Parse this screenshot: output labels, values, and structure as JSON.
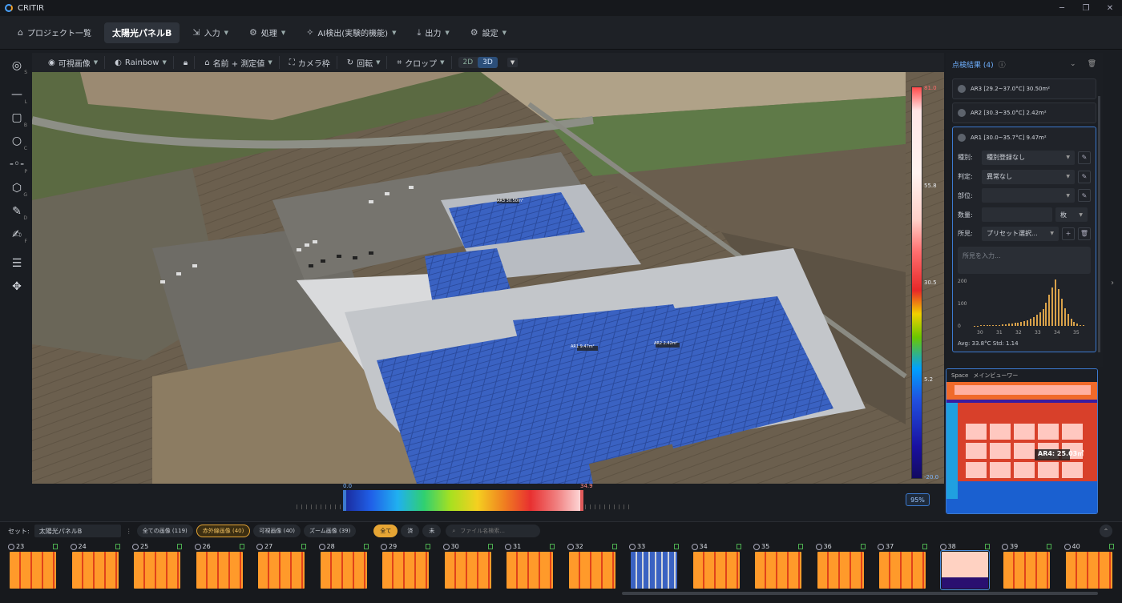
{
  "app": {
    "title": "CRITIR",
    "win_min": "─",
    "win_max": "❐",
    "win_close": "✕"
  },
  "menu": [
    {
      "icon": "⌂",
      "label": "プロジェクト一覧",
      "active": false,
      "caret": false
    },
    {
      "icon": "",
      "label": "太陽光パネルB",
      "active": true,
      "caret": false
    },
    {
      "icon": "⇲",
      "label": "入力",
      "active": false,
      "caret": true
    },
    {
      "icon": "⚙",
      "label": "処理",
      "active": false,
      "caret": true
    },
    {
      "icon": "✧",
      "label": "AI検出(実験的機能)",
      "active": false,
      "caret": true
    },
    {
      "icon": "⤓",
      "label": "出力",
      "active": false,
      "caret": true
    },
    {
      "icon": "⚙",
      "label": "設定",
      "active": false,
      "caret": true
    }
  ],
  "tools": [
    {
      "name": "select-tool",
      "glyph": "◎",
      "key": "S"
    },
    {
      "name": "line-tool",
      "glyph": "—",
      "key": "L"
    },
    {
      "name": "box-tool",
      "glyph": "▢",
      "key": "B"
    },
    {
      "name": "circle-tool",
      "glyph": "○",
      "key": "C"
    },
    {
      "name": "point-tool",
      "glyph": "-◦-",
      "key": "P"
    },
    {
      "name": "polygon-tool",
      "glyph": "⬡",
      "key": "G"
    },
    {
      "name": "draw-tool",
      "glyph": "✎",
      "key": "D"
    },
    {
      "name": "free-tool",
      "glyph": "✍",
      "key": "F"
    },
    {
      "name": "adjust-tool",
      "glyph": "☰",
      "key": ""
    },
    {
      "name": "move-tool",
      "glyph": "✥",
      "key": ""
    }
  ],
  "viewbar": {
    "visible": "可視画像",
    "palette": "Rainbow",
    "label_mode": "名前 + 測定値",
    "camera": "カメラ枠",
    "rotate": "回転",
    "crop": "クロップ",
    "mode2d": "2D",
    "mode3d": "3D"
  },
  "colorbar": {
    "max": "81.0",
    "v2": "55.8",
    "v3": "30.5",
    "v4": "5.2",
    "min": "-20.0"
  },
  "histbar": {
    "min": "0.0",
    "max": "34.9",
    "zoom": "95%"
  },
  "viewport_labels": {
    "l1": "AR3 30.50m²",
    "l2": "AR1 9.47m²",
    "l3": "AR2 2.42m²"
  },
  "results": {
    "title": "点検結果 (4)",
    "areas": [
      {
        "label": "AR3 [29.2~37.0°C] 30.50m²"
      },
      {
        "label": "AR2 [30.3~35.0°C] 2.42m²"
      },
      {
        "label": "AR1 [30.0~35.7°C] 9.47m²"
      }
    ],
    "fields": {
      "type_label": "種別:",
      "type_value": "種別登録なし",
      "judge_label": "判定:",
      "judge_value": "異常なし",
      "part_label": "部位:",
      "part_value": "",
      "qty_label": "数量:",
      "qty_unit": "枚",
      "note_label": "所見:",
      "note_value": "プリセット選択...",
      "memo_placeholder": "所見を入力..."
    },
    "histogram": {
      "yticks": [
        "200",
        "100",
        "0"
      ],
      "xticks": [
        "30",
        "31",
        "32",
        "33",
        "34",
        "35"
      ],
      "bins": [
        1,
        1,
        2,
        2,
        2,
        3,
        3,
        2,
        3,
        4,
        5,
        6,
        7,
        8,
        9,
        11,
        13,
        15,
        18,
        22,
        28,
        35,
        44,
        60,
        80,
        100,
        120,
        95,
        70,
        45,
        30,
        18,
        10,
        6,
        3,
        2
      ],
      "stats": "Avg: 33.8°C   Std: 1.14"
    }
  },
  "minimap": {
    "space": "Space",
    "title": "メインビューワー",
    "tag": "AR4: 25.03㎡"
  },
  "filmbar": {
    "set_label": "セット:",
    "set_value": "太陽光パネルB",
    "filters": [
      {
        "label": "全ての画像 (119)",
        "on": false
      },
      {
        "label": "赤外線画像 (40)",
        "on": true
      },
      {
        "label": "可視画像 (40)",
        "on": false
      },
      {
        "label": "ズーム画像 (39)",
        "on": false
      }
    ],
    "status": [
      {
        "label": "全て",
        "on": true
      },
      {
        "label": "済",
        "on": false
      },
      {
        "label": "未",
        "on": false
      }
    ],
    "search_placeholder": "ファイル名検索...",
    "thumbs": [
      {
        "num": "23",
        "kind": "ir"
      },
      {
        "num": "24",
        "kind": "ir"
      },
      {
        "num": "25",
        "kind": "ir"
      },
      {
        "num": "26",
        "kind": "ir"
      },
      {
        "num": "27",
        "kind": "ir"
      },
      {
        "num": "28",
        "kind": "ir"
      },
      {
        "num": "29",
        "kind": "ir"
      },
      {
        "num": "30",
        "kind": "ir"
      },
      {
        "num": "31",
        "kind": "ir"
      },
      {
        "num": "32",
        "kind": "ir"
      },
      {
        "num": "33",
        "kind": "vis"
      },
      {
        "num": "34",
        "kind": "ir"
      },
      {
        "num": "35",
        "kind": "ir"
      },
      {
        "num": "36",
        "kind": "ir"
      },
      {
        "num": "37",
        "kind": "ir"
      },
      {
        "num": "38",
        "kind": "sel"
      },
      {
        "num": "39",
        "kind": "ir"
      },
      {
        "num": "40",
        "kind": "ir"
      }
    ]
  }
}
